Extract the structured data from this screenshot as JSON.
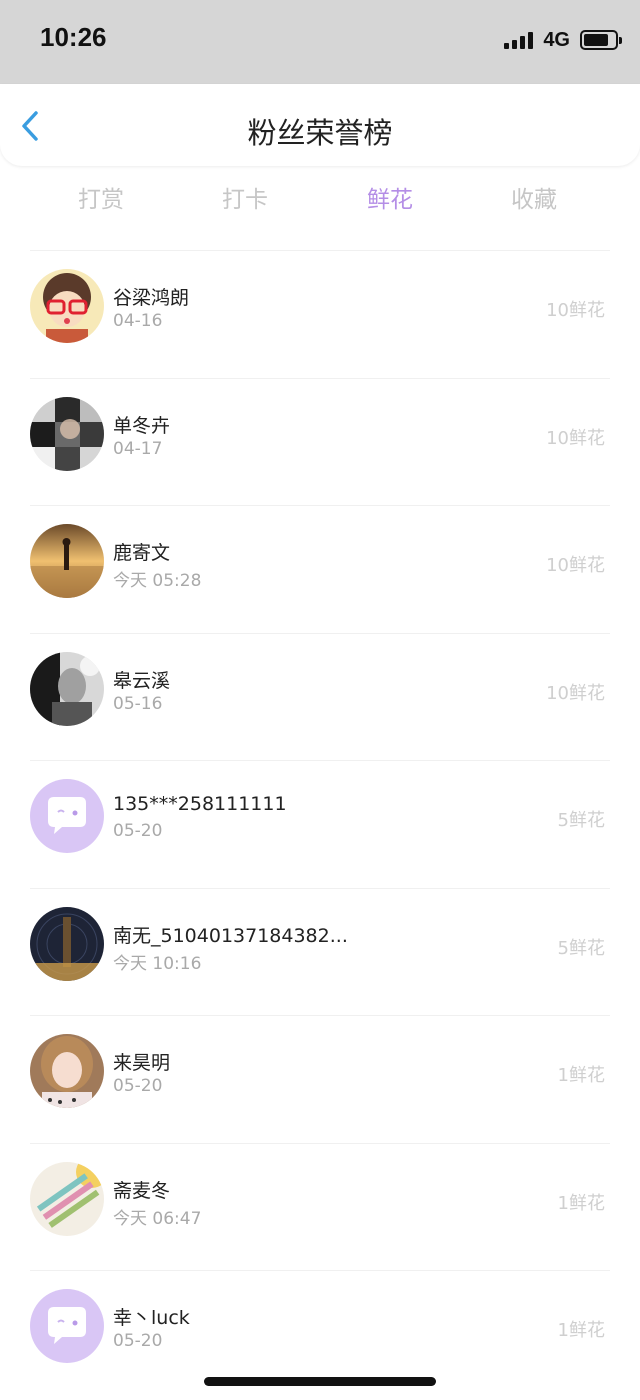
{
  "status_bar": {
    "time": "10:26",
    "network": "4G"
  },
  "nav": {
    "title": "粉丝荣誉榜"
  },
  "tabs": [
    {
      "label": "打赏",
      "active": false
    },
    {
      "label": "打卡",
      "active": false
    },
    {
      "label": "鲜花",
      "active": true
    },
    {
      "label": "收藏",
      "active": false
    }
  ],
  "colors": {
    "accent": "#b48ee6",
    "muted": "#c6c6c6",
    "back_arrow": "#3a9de0"
  },
  "items": [
    {
      "name": "谷梁鸿朗",
      "time": "04-16",
      "count": "10鲜花",
      "avatar": "cartoon-girl-red-glasses-avatar"
    },
    {
      "name": "单冬卉",
      "time": "04-17",
      "count": "10鲜花",
      "avatar": "mosaic-portrait-avatar"
    },
    {
      "name": "鹿寄文",
      "time": "今天 05:28",
      "count": "10鲜花",
      "avatar": "sunset-silhouette-avatar"
    },
    {
      "name": "皋云溪",
      "time": "05-16",
      "count": "10鲜花",
      "avatar": "black-white-portrait-avatar"
    },
    {
      "name": "135***258111111",
      "time": "05-20",
      "count": "5鲜花",
      "avatar": "default-chat-bubble-avatar"
    },
    {
      "name": "南无_51040137184382...",
      "time": "今天 10:16",
      "count": "5鲜花",
      "avatar": "night-tower-avatar"
    },
    {
      "name": "来昊明",
      "time": "05-20",
      "count": "1鲜花",
      "avatar": "girl-peace-sign-avatar"
    },
    {
      "name": "斋麦冬",
      "time": "今天 06:47",
      "count": "1鲜花",
      "avatar": "colorful-pens-avatar"
    },
    {
      "name": "幸丶luck",
      "time": "05-20",
      "count": "1鲜花",
      "avatar": "default-chat-bubble-avatar"
    }
  ]
}
